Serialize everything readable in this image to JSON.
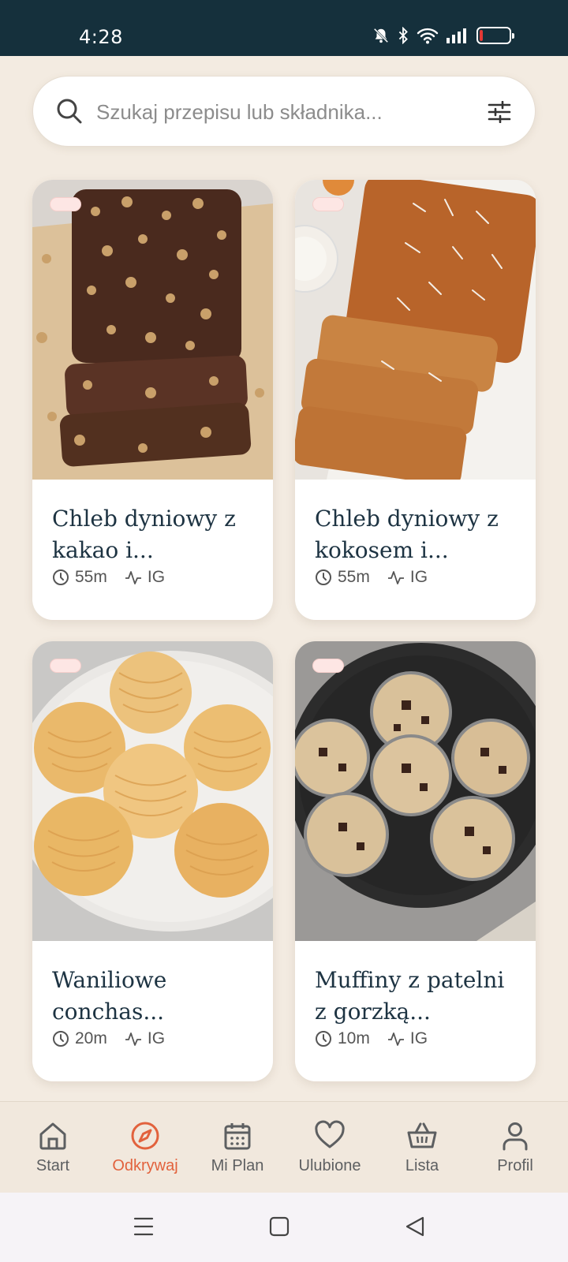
{
  "status_bar": {
    "time": "4:28"
  },
  "search": {
    "placeholder": "Szukaj przepisu lub składnika..."
  },
  "recipes": [
    {
      "title": "Chleb dyniowy z kakao i...",
      "time": "55m",
      "ig": "IG"
    },
    {
      "title": "Chleb dyniowy z kokosem i...",
      "time": "55m",
      "ig": "IG"
    },
    {
      "title": "Waniliowe conchas...",
      "time": "20m",
      "ig": "IG"
    },
    {
      "title": "Muffiny z patelni z gorzką...",
      "time": "10m",
      "ig": "IG"
    }
  ],
  "nav": {
    "items": [
      {
        "label": "Start",
        "icon": "home-icon"
      },
      {
        "label": "Odkrywaj",
        "icon": "compass-icon",
        "active": true
      },
      {
        "label": "Mi Plan",
        "icon": "calendar-icon"
      },
      {
        "label": "Ulubione",
        "icon": "heart-icon"
      },
      {
        "label": "Lista",
        "icon": "basket-icon"
      },
      {
        "label": "Profil",
        "icon": "user-icon"
      }
    ]
  },
  "colors": {
    "accent": "#e2623d",
    "status_bar": "#15303c",
    "background": "#f3ebe1",
    "title_text": "#1d3342"
  }
}
